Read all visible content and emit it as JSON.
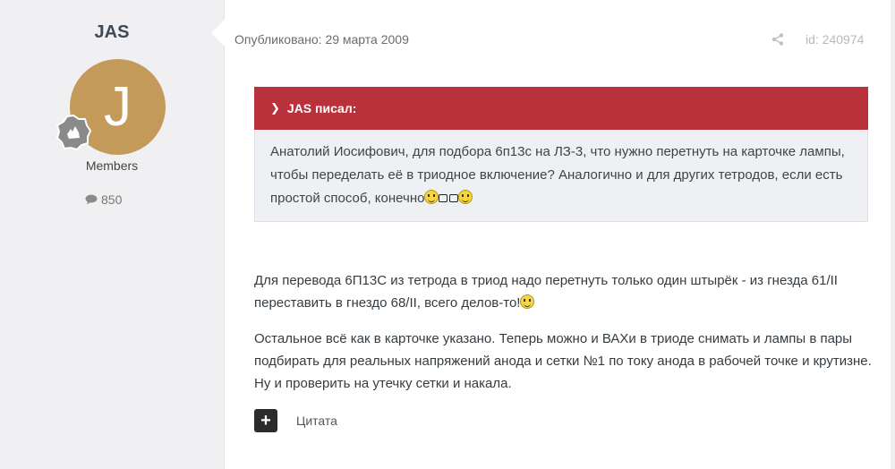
{
  "author": {
    "name": "JAS",
    "avatar_letter": "J",
    "group": "Members",
    "post_count": "850",
    "avatar_color": "#c39a5a"
  },
  "post": {
    "published": "Опубликовано: 29 марта 2009",
    "id": "id: 240974",
    "quote": {
      "header": "JAS писал:",
      "text": "Анатолий Иосифович, для подбора 6п13с на ЛЗ-3, что нужно перетнуть на карточке лампы, чтобы переделать её в триодное включение? Аналогично и для других тетродов, если есть простой способ, конечно"
    },
    "paragraph1": "Для перевода 6П13С из тетрода в триод надо перетнуть только один штырёк - из гнезда 61/II переставить в гнездо 68/II, всего делов-то!",
    "paragraph2": "Остальное всё как в карточке указано. Теперь можно и ВАХи в триоде снимать и лампы в пары подбирать для реальных напряжений анода и сетки №1 по току анода в рабочей точке и крутизне. Ну и проверить на утечку сетки и накала.",
    "quote_action": "Цитата",
    "accent_color": "#b9313a"
  }
}
